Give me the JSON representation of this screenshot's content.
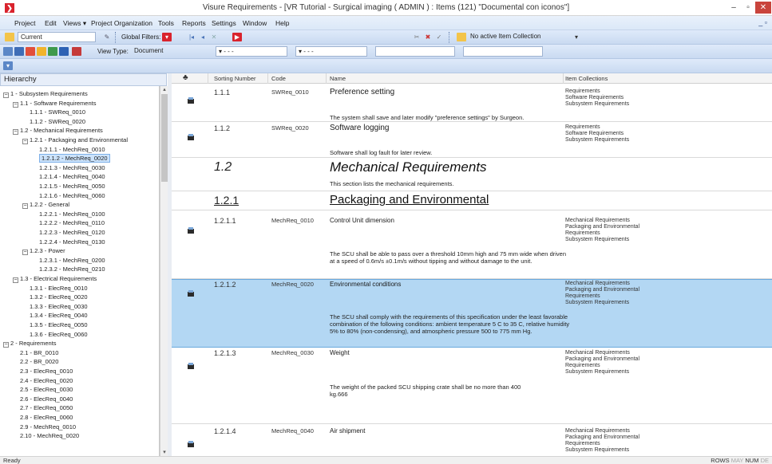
{
  "window": {
    "title": "Visure Requirements - [VR Tutorial - Surgical imaging ( ADMIN ) : Items (121) \"Documental con iconos\"]",
    "min": "–",
    "max": "▫",
    "close": "✕",
    "icon_glyph": "❯"
  },
  "menu": {
    "items": [
      "Project",
      "Edit",
      "Views ▾",
      "Project Organization",
      "Tools",
      "Reports",
      "Settings",
      "Window",
      "Help"
    ],
    "mdi": "_ ▫"
  },
  "toolbar1": {
    "current_value": "Current",
    "global_filters_label": "Global Filters:",
    "item_collection_value": "No active Item Collection"
  },
  "toolbar2": {
    "view_type_label": "View Type:",
    "view_type_value": "Document",
    "dots1": "▾ - - -",
    "dots2": "▾ - - -"
  },
  "hierarchy": {
    "title": "Hierarchy",
    "items": [
      {
        "label": "1 - Subsystem Requirements",
        "indent": 0,
        "exp": "−"
      },
      {
        "label": "1.1 - Software Requirements",
        "indent": 1,
        "exp": "−"
      },
      {
        "label": "1.1.1 - SWReq_0010",
        "indent": 2,
        "exp": ""
      },
      {
        "label": "1.1.2 - SWReq_0020",
        "indent": 2,
        "exp": ""
      },
      {
        "label": "1.2 - Mechanical Requirements",
        "indent": 1,
        "exp": "−"
      },
      {
        "label": "1.2.1 - Packaging and Environmental",
        "indent": 2,
        "exp": "−"
      },
      {
        "label": "1.2.1.1 - MechReq_0010",
        "indent": 3,
        "exp": ""
      },
      {
        "label": "1.2.1.2 - MechReq_0020",
        "indent": 3,
        "exp": "",
        "selected": true
      },
      {
        "label": "1.2.1.3 - MechReq_0030",
        "indent": 3,
        "exp": ""
      },
      {
        "label": "1.2.1.4 - MechReq_0040",
        "indent": 3,
        "exp": ""
      },
      {
        "label": "1.2.1.5 - MechReq_0050",
        "indent": 3,
        "exp": ""
      },
      {
        "label": "1.2.1.6 - MechReq_0060",
        "indent": 3,
        "exp": ""
      },
      {
        "label": "1.2.2 - General",
        "indent": 2,
        "exp": "−"
      },
      {
        "label": "1.2.2.1 - MechReq_0100",
        "indent": 3,
        "exp": ""
      },
      {
        "label": "1.2.2.2 - MechReq_0110",
        "indent": 3,
        "exp": ""
      },
      {
        "label": "1.2.2.3 - MechReq_0120",
        "indent": 3,
        "exp": ""
      },
      {
        "label": "1.2.2.4 - MechReq_0130",
        "indent": 3,
        "exp": ""
      },
      {
        "label": "1.2.3 - Power",
        "indent": 2,
        "exp": "−"
      },
      {
        "label": "1.2.3.1 - MechReq_0200",
        "indent": 3,
        "exp": ""
      },
      {
        "label": "1.2.3.2 - MechReq_0210",
        "indent": 3,
        "exp": ""
      },
      {
        "label": "1.3 - Electrical Requirements",
        "indent": 1,
        "exp": "−"
      },
      {
        "label": "1.3.1 - ElecReq_0010",
        "indent": 2,
        "exp": ""
      },
      {
        "label": "1.3.2 - ElecReq_0020",
        "indent": 2,
        "exp": ""
      },
      {
        "label": "1.3.3 - ElecReq_0030",
        "indent": 2,
        "exp": ""
      },
      {
        "label": "1.3.4 - ElecReq_0040",
        "indent": 2,
        "exp": ""
      },
      {
        "label": "1.3.5 - ElecReq_0050",
        "indent": 2,
        "exp": ""
      },
      {
        "label": "1.3.6 - ElecReq_0060",
        "indent": 2,
        "exp": ""
      },
      {
        "label": "2 - Requirements",
        "indent": 0,
        "exp": "−"
      },
      {
        "label": "2.1 - BR_0010",
        "indent": 1,
        "exp": ""
      },
      {
        "label": "2.2 - BR_0020",
        "indent": 1,
        "exp": ""
      },
      {
        "label": "2.3 - ElecReq_0010",
        "indent": 1,
        "exp": ""
      },
      {
        "label": "2.4 - ElecReq_0020",
        "indent": 1,
        "exp": ""
      },
      {
        "label": "2.5 - ElecReq_0030",
        "indent": 1,
        "exp": ""
      },
      {
        "label": "2.6 - ElecReq_0040",
        "indent": 1,
        "exp": ""
      },
      {
        "label": "2.7 - ElecReq_0050",
        "indent": 1,
        "exp": ""
      },
      {
        "label": "2.8 - ElecReq_0060",
        "indent": 1,
        "exp": ""
      },
      {
        "label": "2.9 - MechReq_0010",
        "indent": 1,
        "exp": ""
      },
      {
        "label": "2.10 - MechReq_0020",
        "indent": 1,
        "exp": ""
      }
    ]
  },
  "grid": {
    "columns": {
      "icon": "♣",
      "sorting": "Sorting Number",
      "code": "Code",
      "name": "Name",
      "collections": "Item Collections"
    },
    "rows": [
      {
        "num": "1.1.1",
        "code": "SWReq_0010",
        "name": "Preference setting",
        "desc": "The system shall save and later modify \"preference settings\" by Surgeon.",
        "collections": [
          "Requirements",
          "Software Requirements",
          "Subsystem Requirements"
        ]
      },
      {
        "num": "1.1.2",
        "code": "SWReq_0020",
        "name": "Software logging",
        "desc": "Software shall log fault for later review.",
        "collections": [
          "Requirements",
          "Software Requirements",
          "Subsystem Requirements"
        ]
      },
      {
        "num": "1.2",
        "name": "Mechanical Requirements",
        "desc": "This section lists the mechanical requirements."
      },
      {
        "num": "1.2.1",
        "name": "Packaging and Environmental"
      },
      {
        "num": "1.2.1.1",
        "code": "MechReq_0010",
        "name": "Control Unit dimension",
        "desc": "The SCU shall be able to pass over a threshold 10mm high and 75 mm wide  when driven at a speed of 0.6m/s ±0.1m/s without tipping and without damage to the unit.",
        "collections": [
          "Mechanical Requirements",
          "Packaging and Environmental",
          "Requirements",
          "Subsystem Requirements"
        ]
      },
      {
        "num": "1.2.1.2",
        "code": "MechReq_0020",
        "name": "Environmental conditions",
        "desc": "The SCU shall comply with the requirements of this specification under the least favorable combination of the following conditions: ambient temperature 5 C to 35 C, relative humidity 5% to 80% (non-condensing), and atmospheric pressure 500 to 775 mm Hg.",
        "collections": [
          "Mechanical Requirements",
          "Packaging and Environmental",
          "Requirements",
          "Subsystem Requirements"
        ]
      },
      {
        "num": "1.2.1.3",
        "code": "MechReq_0030",
        "name": "Weight",
        "desc": "The weight of the packed SCU shipping crate shall be no more than 400 kg.666",
        "collections": [
          "Mechanical Requirements",
          "Packaging and Environmental",
          "Requirements",
          "Subsystem Requirements"
        ]
      },
      {
        "num": "1.2.1.4",
        "code": "MechReq_0040",
        "name": "Air shipment",
        "collections": [
          "Mechanical Requirements",
          "Packaging and Environmental",
          "Requirements",
          "Subsystem Requirements"
        ]
      }
    ]
  },
  "status": {
    "left": "Ready",
    "rows": "ROWS",
    "may": "MAY",
    "num": "NUM",
    "de": "DE"
  },
  "colors": {
    "selection": "#b3d7f3",
    "accent": "#d9232d",
    "toolbar": "#c9daf1"
  }
}
